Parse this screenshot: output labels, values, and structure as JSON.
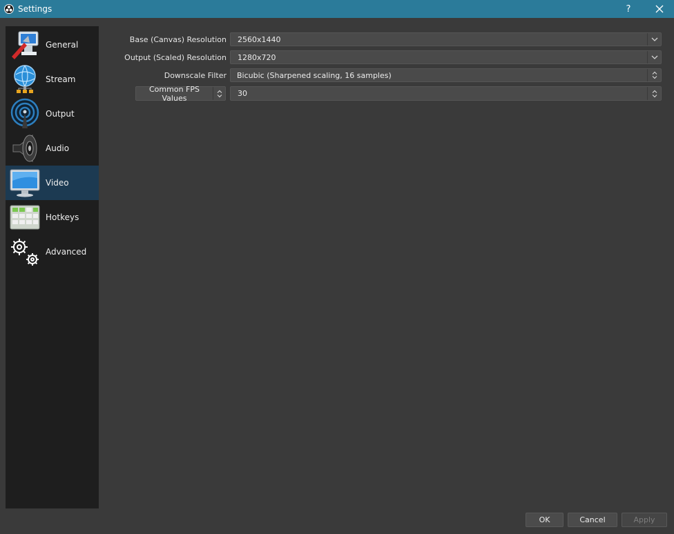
{
  "window": {
    "title": "Settings",
    "help_label": "?",
    "close_label": "✕"
  },
  "sidebar": {
    "items": [
      {
        "label": "General",
        "icon": "general-icon",
        "selected": false
      },
      {
        "label": "Stream",
        "icon": "stream-icon",
        "selected": false
      },
      {
        "label": "Output",
        "icon": "output-icon",
        "selected": false
      },
      {
        "label": "Audio",
        "icon": "audio-icon",
        "selected": false
      },
      {
        "label": "Video",
        "icon": "video-icon",
        "selected": true
      },
      {
        "label": "Hotkeys",
        "icon": "hotkeys-icon",
        "selected": false
      },
      {
        "label": "Advanced",
        "icon": "advanced-icon",
        "selected": false
      }
    ]
  },
  "video": {
    "base_resolution": {
      "label": "Base (Canvas) Resolution",
      "value": "2560x1440"
    },
    "output_resolution": {
      "label": "Output (Scaled) Resolution",
      "value": "1280x720"
    },
    "downscale_filter": {
      "label": "Downscale Filter",
      "value": "Bicubic (Sharpened scaling, 16 samples)"
    },
    "fps": {
      "mode_label": "Common FPS Values",
      "value": "30"
    }
  },
  "buttons": {
    "ok": "OK",
    "cancel": "Cancel",
    "apply": "Apply"
  },
  "colors": {
    "titlebar": "#2b7b9a",
    "background": "#3a3a3a",
    "sidebar": "#1e1e1e",
    "selected": "#1c3a52"
  }
}
